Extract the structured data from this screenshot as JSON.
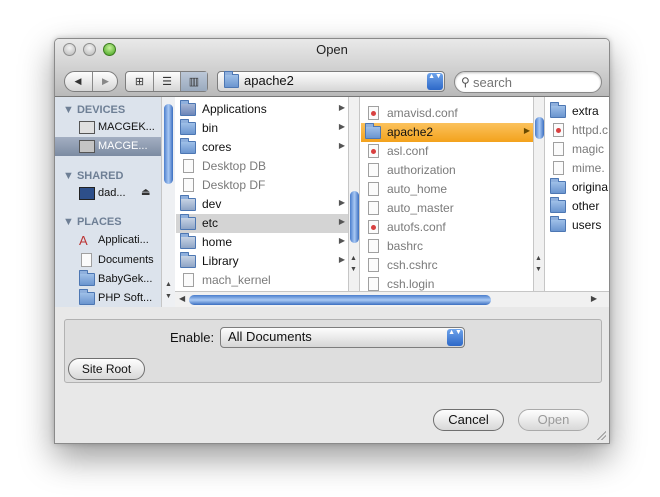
{
  "window": {
    "title": "Open"
  },
  "toolbar": {
    "back_glyph": "◀",
    "forward_glyph": "▶",
    "view_icons": [
      "⊞",
      "☰",
      "▥"
    ],
    "path": "apache2",
    "stepper_glyph": "▲▼"
  },
  "search": {
    "placeholder": "search",
    "icon": "search-icon"
  },
  "sidebar": {
    "devices_header": "▼ DEVICES",
    "shared_header": "▼ SHARED",
    "places_header": "▼ PLACES",
    "devices": [
      "MACGEK...",
      "MACGE..."
    ],
    "shared": [
      "dad..."
    ],
    "places": [
      "Applicati...",
      "Documents",
      "BabyGek...",
      "PHP Soft..."
    ],
    "eject_glyph": "⏏"
  },
  "columns": {
    "col1": [
      "Applications",
      "bin",
      "cores",
      "Desktop DB",
      "Desktop DF",
      "dev",
      "etc",
      "home",
      "Library",
      "mach_kernel"
    ],
    "col2": [
      "amavisd.conf",
      "apache2",
      "asl.conf",
      "authorization",
      "auto_home",
      "auto_master",
      "autofs.conf",
      "bashrc",
      "csh.cshrc",
      "csh.login"
    ],
    "col3": [
      "extra",
      "httpd.c",
      "magic",
      "mime.",
      "origina",
      "other",
      "users"
    ]
  },
  "arrow_glyph": "▶",
  "accessory": {
    "enable_label": "Enable:",
    "enable_value": "All Documents",
    "site_root": "Site Root"
  },
  "buttons": {
    "cancel": "Cancel",
    "open": "Open"
  },
  "colors": {
    "selection_orange": "#f3a21c",
    "sidebar_bg": "#dce3ec",
    "accent_blue": "#2d68c8"
  }
}
